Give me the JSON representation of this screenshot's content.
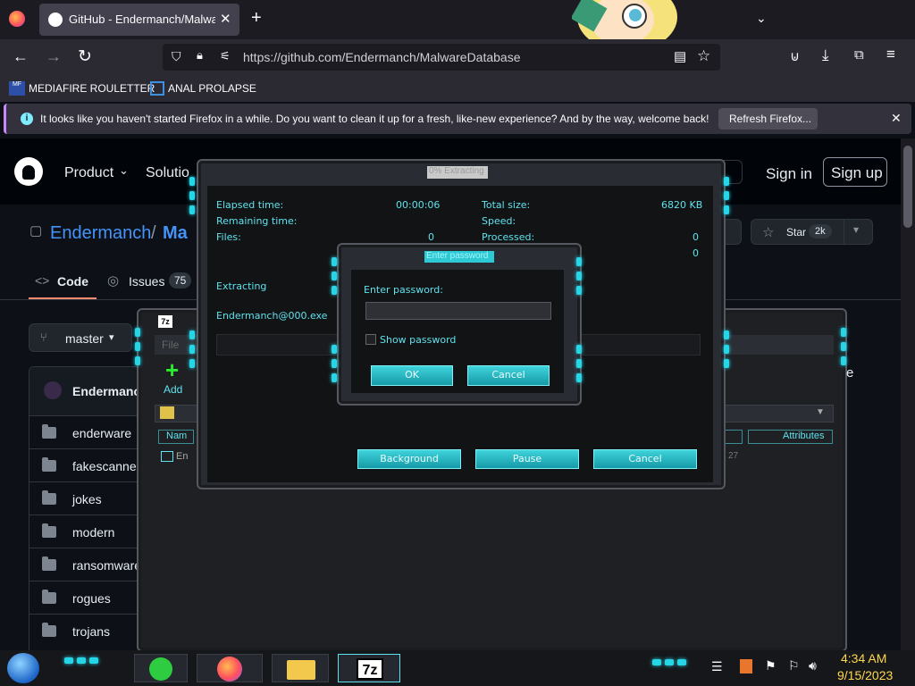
{
  "browser": {
    "tab_title": "GitHub - Endermanch/Malware",
    "url": "https://github.com/Endermanch/MalwareDatabase",
    "bookmarks": [
      "MEDIAFIRE ROULETTER",
      "ANAL PROLAPSE"
    ],
    "notice_text": "It looks like you haven't started Firefox in a while. Do you want to clean it up for a fresh, like-new experience? And by the way, welcome back!",
    "notice_button": "Refresh Firefox..."
  },
  "github": {
    "nav_product": "Product",
    "nav_solutions": "Solutio",
    "sign_in": "Sign in",
    "sign_up": "Sign up",
    "repo_owner": "Endermanch",
    "repo_sep": "/",
    "repo_name": "Ma",
    "star_label": "Star",
    "star_count": "2k",
    "tab_code": "Code",
    "tab_issues": "Issues",
    "issues_count": "75",
    "branch": "master",
    "commit_author": "Endermanch",
    "files": [
      "enderware",
      "fakescanners",
      "jokes",
      "modern",
      "ransomware",
      "rogues",
      "trojans"
    ]
  },
  "sevenzip_bg": {
    "menu_file": "File",
    "add_label": "Add",
    "col_name": "Nam",
    "col_attributes": "Attributes",
    "row_name": "En",
    "row_tail": "27",
    "right_letter": "e"
  },
  "extract_dialog": {
    "title": "0% Extracting",
    "elapsed_label": "Elapsed time:",
    "elapsed_value": "00:00:06",
    "remaining_label": "Remaining time:",
    "files_label": "Files:",
    "files_value": "0",
    "total_size_label": "Total size:",
    "total_size_value": "6820 KB",
    "speed_label": "Speed:",
    "processed_label": "Processed:",
    "processed_value": "0",
    "extra_value": "0",
    "status": "Extracting",
    "current_file": "Endermanch@000.exe",
    "btn_background": "Background",
    "btn_pause": "Pause",
    "btn_cancel": "Cancel"
  },
  "password_dialog": {
    "title": "Enter password",
    "prompt": "Enter password:",
    "password_value": "",
    "show_password": "Show password",
    "ok": "OK",
    "cancel": "Cancel"
  },
  "taskbar": {
    "time": "4:34 AM",
    "date": "9/15/2023",
    "sevenzip_icon_text": "7z"
  },
  "colors": {
    "accent_cyan": "#26d6e6",
    "github_link": "#4493f8"
  }
}
